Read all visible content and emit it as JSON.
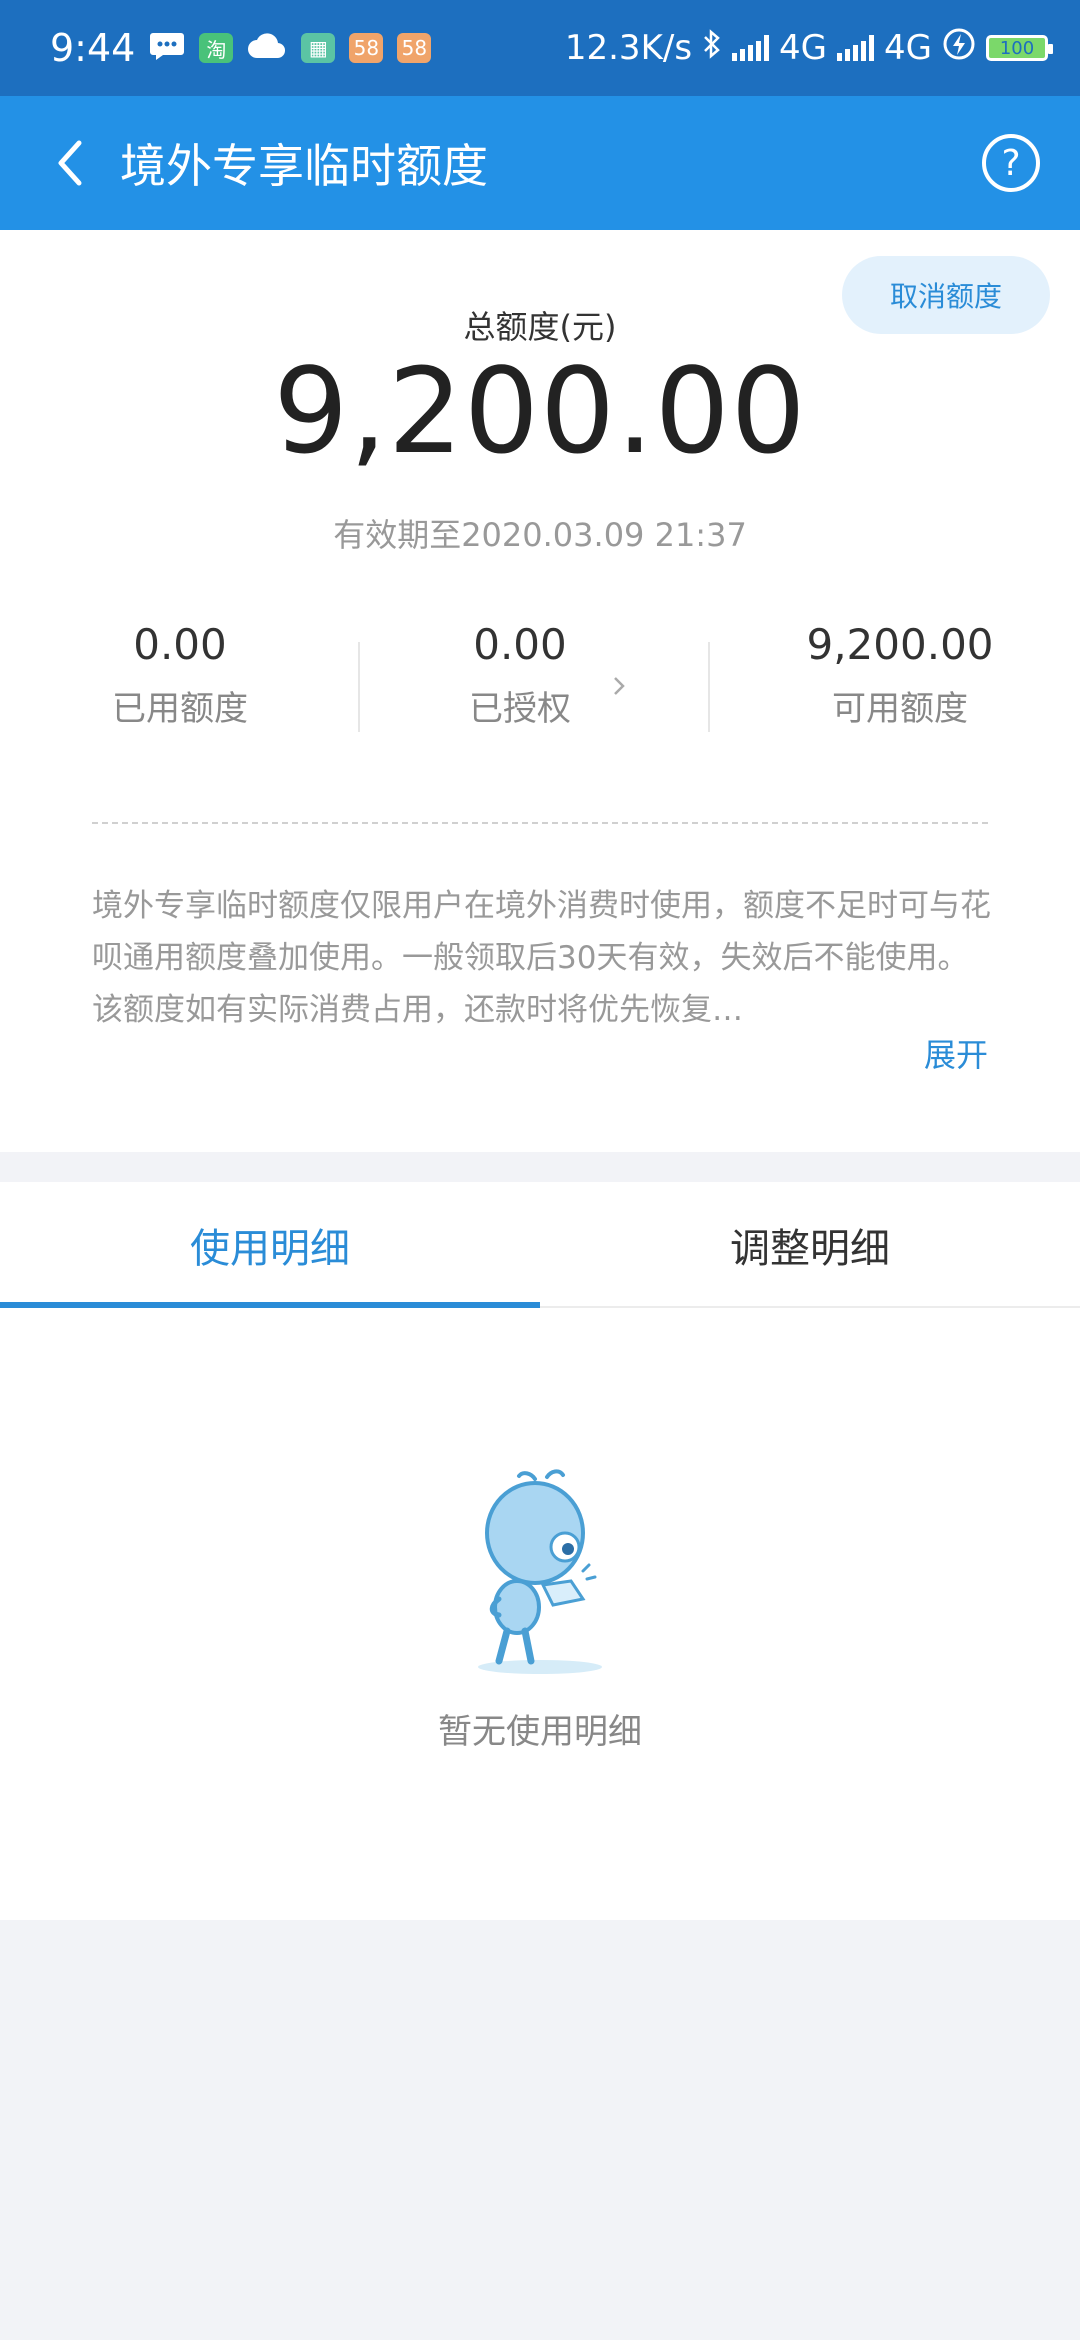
{
  "status_bar": {
    "time": "9:44",
    "net_speed": "12.3K/s",
    "network1": "4G",
    "network2": "4G",
    "battery": "100",
    "app_icons": [
      "message-icon",
      "taobao-icon",
      "cloud-phone-icon",
      "app-icon",
      "58-icon",
      "58-icon"
    ],
    "app_badge_58": "58"
  },
  "header": {
    "title": "境外专享临时额度",
    "help_symbol": "?"
  },
  "limit": {
    "cancel_label": "取消额度",
    "total_label": "总额度(元)",
    "total_amount": "9,200.00",
    "validity": "有效期至2020.03.09 21:37",
    "used_value": "0.00",
    "used_label": "已用额度",
    "authorized_value": "0.00",
    "authorized_label": "已授权",
    "available_value": "9,200.00",
    "available_label": "可用额度",
    "description": "境外专享临时额度仅限用户在境外消费时使用，额度不足时可与花呗通用额度叠加使用。一般领取后30天有效，失效后不能使用。该额度如有实际消费占用，还款时将优先恢复…",
    "expand_label": "展开"
  },
  "tabs": {
    "active": "使用明细",
    "inactive": "调整明细"
  },
  "empty_state": {
    "text": "暂无使用明细"
  },
  "colors": {
    "status_bar": "#1d6fbf",
    "header": "#2391e6",
    "accent": "#2a8cd7"
  }
}
